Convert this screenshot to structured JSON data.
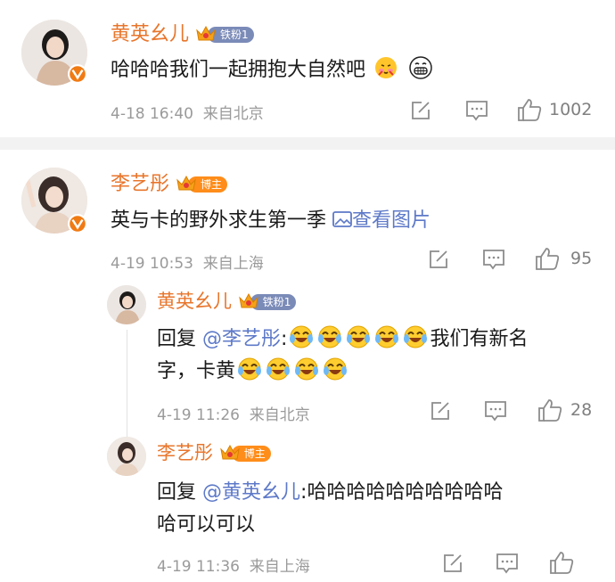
{
  "c1": {
    "name": "黄英幺儿",
    "badge": "铁粉1",
    "text": "哈哈哈我们一起拥抱大自然吧",
    "time": "4-18 16:40",
    "loc": "来自北京",
    "likes": "1002"
  },
  "c2": {
    "name": "李艺彤",
    "badge": "博主",
    "text": "英与卡的野外求生第一季",
    "link": "查看图片",
    "time": "4-19 10:53",
    "loc": "来自上海",
    "likes": "95"
  },
  "r1": {
    "name": "黄英幺儿",
    "badge": "铁粉1",
    "reply_prefix": "回复",
    "mention": "@李艺彤",
    "colon": ":",
    "line1_tail": "我们有新名",
    "line2_a": "字，卡黄",
    "time": "4-19 11:26",
    "loc": "来自北京",
    "likes": "28"
  },
  "r2": {
    "name": "李艺彤",
    "badge": "博主",
    "reply_prefix": "回复",
    "mention": "@黄英幺儿",
    "line1_tail": ":哈哈哈哈哈哈哈哈哈哈",
    "line2": "哈可以可以",
    "time": "4-19 11:36",
    "loc": "来自上海"
  },
  "colors": {
    "name": "#e8762c",
    "link": "#5d79c8",
    "fan_badge": "#7b8bb8",
    "host_badge": "#ff8d1a",
    "verify": "#f07a13"
  }
}
